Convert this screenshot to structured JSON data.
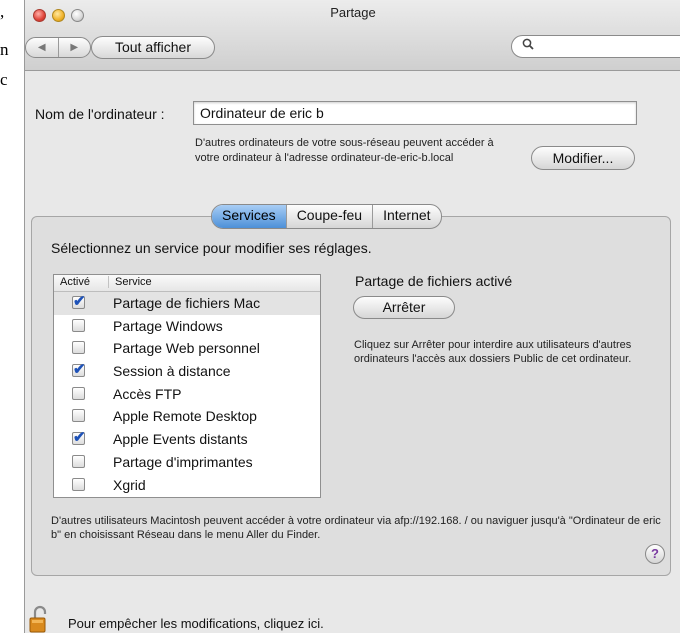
{
  "behind_window": {
    "fragments": [
      ",",
      "n",
      "c"
    ]
  },
  "window": {
    "title": "Partage"
  },
  "toolbar": {
    "back_label": "◀",
    "forward_label": "▶",
    "show_all_label": "Tout afficher",
    "search_placeholder": ""
  },
  "computer_name": {
    "label": "Nom de l'ordinateur :",
    "value": "Ordinateur de eric b",
    "info": "D'autres ordinateurs de votre sous-réseau peuvent accéder à votre ordinateur à l'adresse ordinateur-de-eric-b.local",
    "modify_label": "Modifier..."
  },
  "tabs": [
    {
      "label": "Services",
      "active": true
    },
    {
      "label": "Coupe-feu",
      "active": false
    },
    {
      "label": "Internet",
      "active": false
    }
  ],
  "services": {
    "prompt": "Sélectionnez un service pour modifier ses réglages.",
    "col_enabled": "Activé",
    "col_service": "Service",
    "items": [
      {
        "label": "Partage de fichiers Mac",
        "checked": true,
        "selected": true
      },
      {
        "label": "Partage Windows",
        "checked": false,
        "selected": false
      },
      {
        "label": "Partage Web personnel",
        "checked": false,
        "selected": false
      },
      {
        "label": "Session à distance",
        "checked": true,
        "selected": false
      },
      {
        "label": "Accès FTP",
        "checked": false,
        "selected": false
      },
      {
        "label": "Apple Remote Desktop",
        "checked": false,
        "selected": false
      },
      {
        "label": "Apple Events distants",
        "checked": true,
        "selected": false
      },
      {
        "label": "Partage d'imprimantes",
        "checked": false,
        "selected": false
      },
      {
        "label": "Xgrid",
        "checked": false,
        "selected": false
      }
    ],
    "status": "Partage de fichiers activé",
    "stop_label": "Arrêter",
    "description": "Cliquez sur Arrêter pour interdire aux utilisateurs d'autres ordinateurs l'accès aux dossiers Public de cet ordinateur.",
    "afp_info": "D'autres utilisateurs Macintosh peuvent accéder à votre ordinateur via afp://192.168.     / ou naviguer jusqu'à \"Ordinateur de eric b\" en choisissant Réseau dans le menu Aller du Finder."
  },
  "help_label": "?",
  "lock": {
    "text": "Pour empêcher les modifications, cliquez ici.",
    "icon": "unlocked-padlock-icon"
  }
}
